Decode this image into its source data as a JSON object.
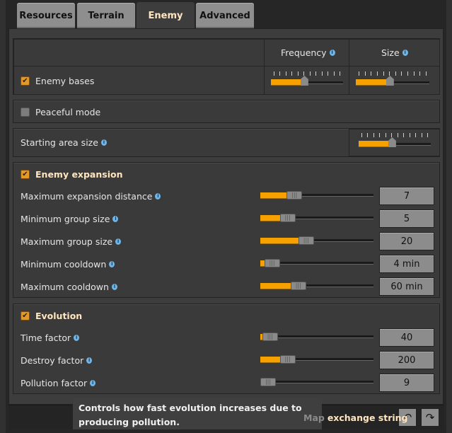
{
  "tabs": [
    {
      "label": "Resources"
    },
    {
      "label": "Terrain"
    },
    {
      "label": "Enemy",
      "selected": true
    },
    {
      "label": "Advanced"
    }
  ],
  "enemy_bases": {
    "columns": {
      "frequency": "Frequency",
      "size": "Size"
    },
    "label": "Enemy bases",
    "checked": true,
    "frequency_level": 0.45,
    "size_level": 0.45
  },
  "peaceful": {
    "label": "Peaceful mode",
    "checked": false
  },
  "starting_area": {
    "label": "Starting area size",
    "level": 0.45
  },
  "expansion": {
    "title": "Enemy expansion",
    "checked": true,
    "rows": [
      {
        "label": "Maximum expansion distance",
        "value": "7",
        "level": 0.27
      },
      {
        "label": "Minimum group size",
        "value": "5",
        "level": 0.2
      },
      {
        "label": "Maximum group size",
        "value": "20",
        "level": 0.39
      },
      {
        "label": "Minimum cooldown",
        "value": "4 min",
        "level": 0.04
      },
      {
        "label": "Maximum cooldown",
        "value": "60 min",
        "level": 0.31
      }
    ]
  },
  "evolution": {
    "title": "Evolution",
    "checked": true,
    "rows": [
      {
        "label": "Time factor",
        "value": "40",
        "level": 0.02
      },
      {
        "label": "Destroy factor",
        "value": "200",
        "level": 0.2
      },
      {
        "label": "Pollution factor",
        "value": "9",
        "level": 0.0
      }
    ]
  },
  "footer": {
    "label_hidden": "Map",
    "label": "exchange string",
    "undo_icon": "undo-icon",
    "redo_icon": "redo-icon"
  },
  "tooltip": {
    "text": "Controls how fast evolution increases due to producing pollution."
  },
  "colors": {
    "accent": "#f6a100",
    "heading": "#ffe6c0",
    "info": "#6fb6e8"
  }
}
